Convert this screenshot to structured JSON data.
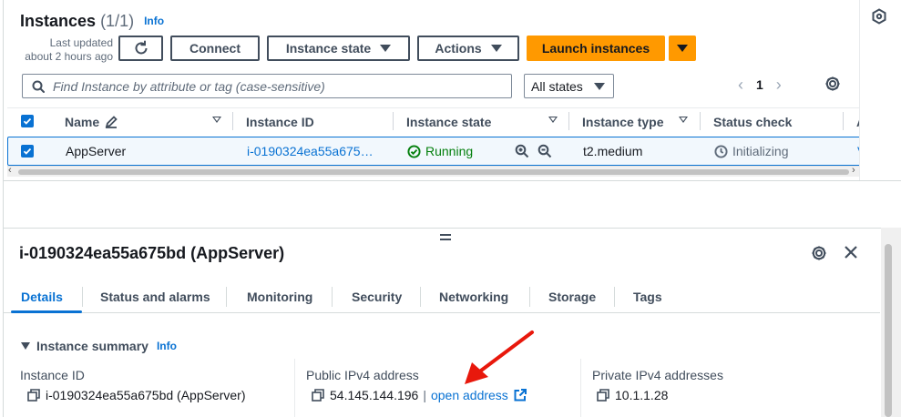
{
  "header": {
    "title": "Instances",
    "count": "(1/1)",
    "info": "Info",
    "last_updated_line1": "Last updated",
    "last_updated_line2": "about 2 hours ago"
  },
  "toolbar": {
    "connect": "Connect",
    "instance_state": "Instance state",
    "actions": "Actions",
    "launch": "Launch instances"
  },
  "search": {
    "placeholder": "Find Instance by attribute or tag (case-sensitive)",
    "state_filter": "All states"
  },
  "pagination": {
    "page": "1"
  },
  "table": {
    "columns": [
      "Name",
      "Instance ID",
      "Instance state",
      "Instance type",
      "Status check",
      "A"
    ],
    "row": {
      "name": "AppServer",
      "instance_id": "i-0190324ea55a675…",
      "state": "Running",
      "type": "t2.medium",
      "status": "Initializing",
      "extra": "V"
    }
  },
  "details": {
    "title": "i-0190324ea55a675bd (AppServer)",
    "tabs": [
      "Details",
      "Status and alarms",
      "Monitoring",
      "Security",
      "Networking",
      "Storage",
      "Tags"
    ],
    "summary_title": "Instance summary",
    "summary_info": "Info",
    "instance_id_label": "Instance ID",
    "instance_id_value": "i-0190324ea55a675bd (AppServer)",
    "public_ip_label": "Public IPv4 address",
    "public_ip_value": "54.145.144.196",
    "public_ip_sep": "|",
    "open_address": "open address",
    "private_ip_label": "Private IPv4 addresses",
    "private_ip_value": "10.1.1.28"
  },
  "colors": {
    "primary": "#ff9900",
    "link": "#0972d3",
    "running": "#037f0c",
    "annotation": "#e8180c"
  },
  "icons": [
    "refresh-icon",
    "search-icon",
    "gear-icon",
    "edit-icon",
    "check-circle-icon",
    "zoom-in-icon",
    "zoom-out-icon",
    "clock-icon",
    "copy-icon",
    "external-link-icon",
    "close-icon",
    "drag-handle-icon",
    "red-annotation-arrow"
  ]
}
